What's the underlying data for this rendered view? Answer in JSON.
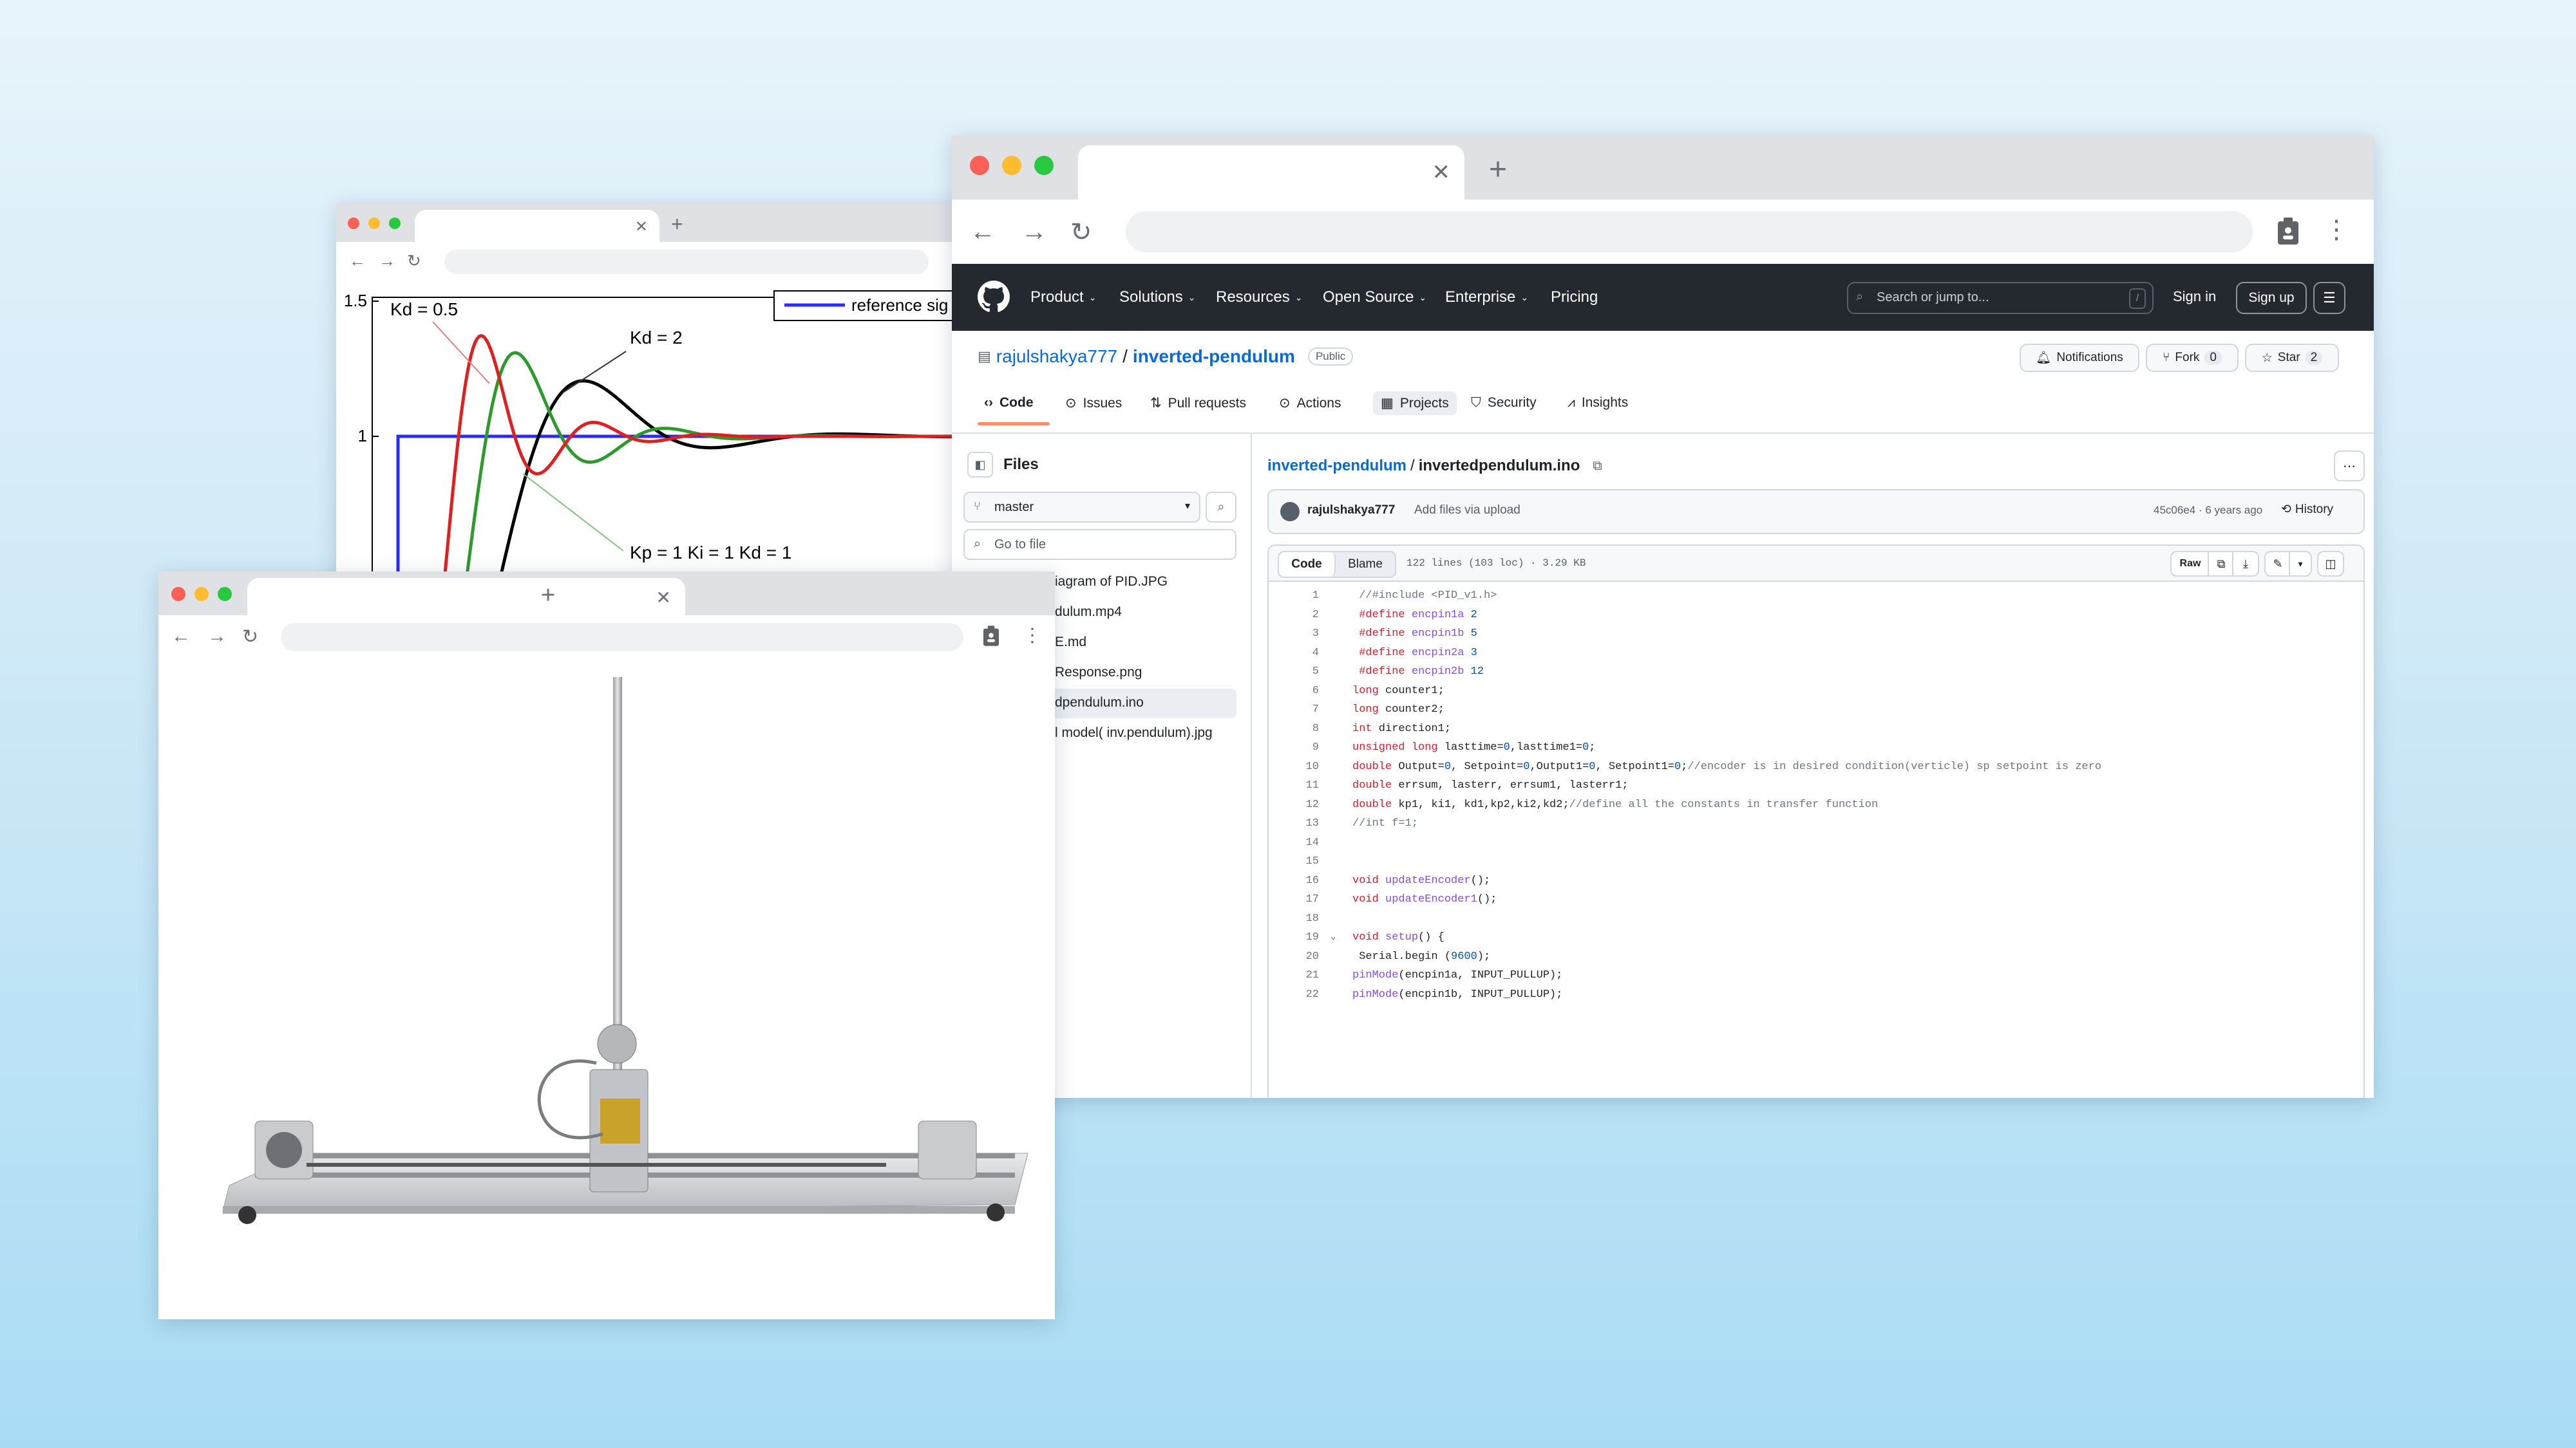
{
  "plot_window": {
    "chart_data": {
      "type": "line",
      "title": "",
      "xlabel": "",
      "ylabel": "",
      "ylim": [
        0,
        1.5
      ],
      "y_ticks": [
        "1.5",
        "1"
      ],
      "legend": "reference sig",
      "annotations": [
        "Kd = 0.5",
        "Kd = 2",
        "Kp = 1   Ki = 1   Kd = 1"
      ],
      "series": [
        {
          "name": "reference sig",
          "color": "#2b2bff"
        },
        {
          "color": "#000000"
        },
        {
          "color": "#e02020"
        },
        {
          "color": "#2c9b2c"
        }
      ]
    }
  },
  "photo_window": {
    "image": "inverted-pendulum-hardware-photo"
  },
  "github": {
    "nav": [
      "Product",
      "Solutions",
      "Resources",
      "Open Source",
      "Enterprise",
      "Pricing"
    ],
    "search_placeholder": "Search or jump to...",
    "search_shortcut": "/",
    "sign_in": "Sign in",
    "sign_up": "Sign up",
    "owner": "rajulshakya777",
    "sep": "/",
    "repo": "inverted-pendulum",
    "visibility": "Public",
    "notifications": "Notifications",
    "fork": "Fork",
    "fork_count": "0",
    "star": "Star",
    "star_count": "2",
    "tabs": [
      "Code",
      "Issues",
      "Pull requests",
      "Actions",
      "Projects",
      "Security",
      "Insights"
    ],
    "files_title": "Files",
    "branch": "master",
    "go_to_file": "Go to file",
    "files": [
      "iagram of PID.JPG",
      "dulum.mp4",
      "E.md",
      "Response.png",
      "dpendulum.ino",
      "l model( inv.pendulum).jpg"
    ],
    "breadcrumb_repo": "inverted-pendulum",
    "breadcrumb_sep": "/",
    "breadcrumb_file": "invertedpendulum.ino",
    "commit_author": "rajulshakya777",
    "commit_msg": "Add files via upload",
    "commit_meta": "45c06e4 · 6 years ago",
    "history": "History",
    "code_tab": "Code",
    "blame_tab": "Blame",
    "file_info": "122 lines (103 loc) · 3.29 KB",
    "raw": "Raw",
    "code": [
      {
        "n": "1",
        "t": " //#include <PID_v1.h>"
      },
      {
        "n": "2",
        "t": " #define encpin1a 2"
      },
      {
        "n": "3",
        "t": " #define encpin1b 5"
      },
      {
        "n": "4",
        "t": " #define encpin2a 3"
      },
      {
        "n": "5",
        "t": " #define encpin2b 12"
      },
      {
        "n": "6",
        "t": "long counter1;"
      },
      {
        "n": "7",
        "t": "long counter2;"
      },
      {
        "n": "8",
        "t": "int direction1;"
      },
      {
        "n": "9",
        "t": "unsigned long lasttime=0,lasttime1=0;"
      },
      {
        "n": "10",
        "t": "double Output=0, Setpoint=0,Output1=0, Setpoint1=0;//encoder is in desired condition(verticle) sp setpoint is zero"
      },
      {
        "n": "11",
        "t": "double errsum, lasterr, errsum1, lasterr1;"
      },
      {
        "n": "12",
        "t": "double kp1, ki1, kd1,kp2,ki2,kd2;//define all the constants in transfer function"
      },
      {
        "n": "13",
        "t": "//int f=1;"
      },
      {
        "n": "14",
        "t": ""
      },
      {
        "n": "15",
        "t": ""
      },
      {
        "n": "16",
        "t": "void updateEncoder();"
      },
      {
        "n": "17",
        "t": "void updateEncoder1();"
      },
      {
        "n": "18",
        "t": ""
      },
      {
        "n": "19",
        "t": "void setup() {"
      },
      {
        "n": "20",
        "t": " Serial.begin (9600);"
      },
      {
        "n": "21",
        "t": "pinMode(encpin1a, INPUT_PULLUP);"
      },
      {
        "n": "22",
        "t": "pinMode(encpin1b, INPUT_PULLUP);"
      }
    ]
  }
}
